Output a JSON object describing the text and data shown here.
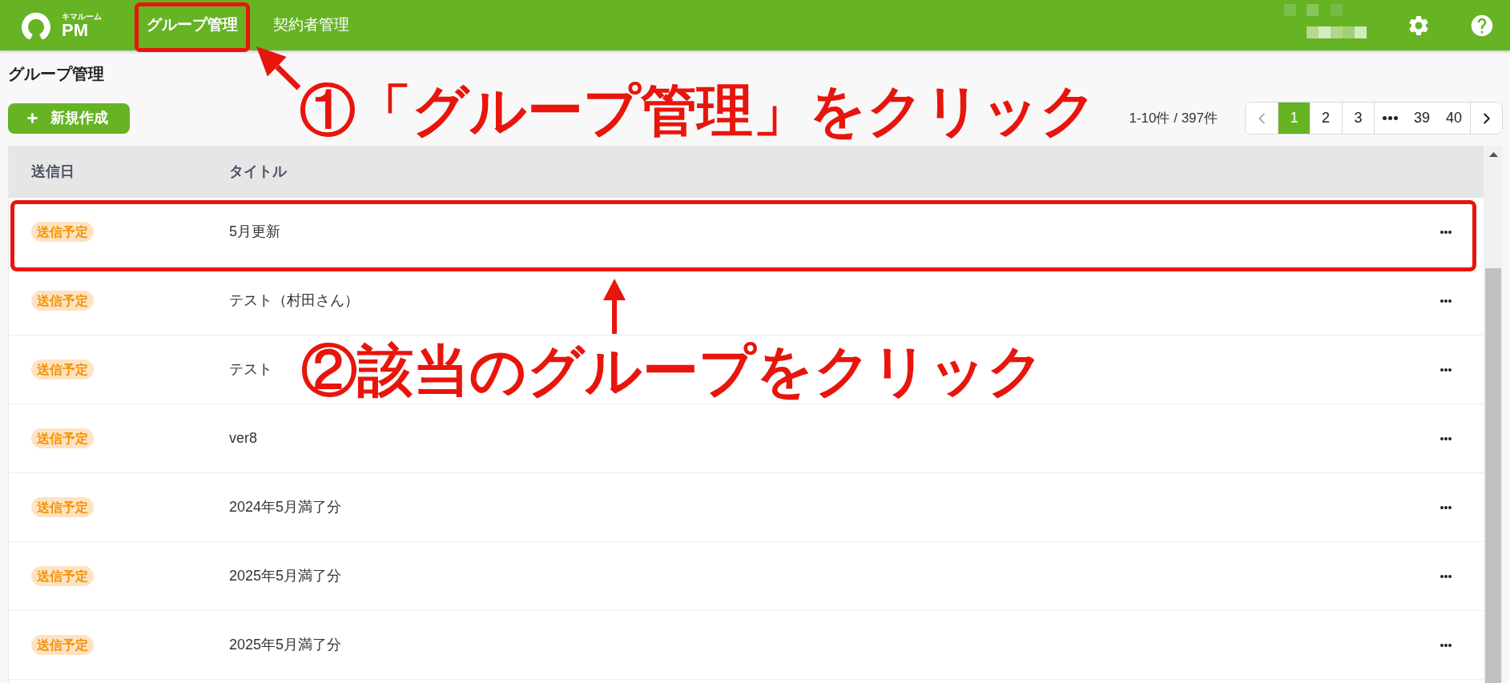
{
  "header": {
    "logo": {
      "caption": "キマルーム",
      "name": "PM"
    },
    "nav": [
      {
        "label": "グループ管理",
        "selected": true,
        "highlighted": true
      },
      {
        "label": "契約者管理",
        "selected": false,
        "highlighted": false
      }
    ]
  },
  "page": {
    "title": "グループ管理",
    "new_button": "新規作成",
    "count": "1-10件 / 397件"
  },
  "pagination": [
    {
      "kind": "prev",
      "disabled": true,
      "selected": false
    },
    {
      "kind": "page",
      "label": "1",
      "selected": true
    },
    {
      "kind": "page",
      "label": "2",
      "selected": false
    },
    {
      "kind": "page",
      "label": "3",
      "selected": false
    },
    {
      "kind": "ellipsis",
      "selected": false
    },
    {
      "kind": "page",
      "label": "39",
      "selected": false
    },
    {
      "kind": "page",
      "label": "40",
      "selected": false
    },
    {
      "kind": "next",
      "disabled": false,
      "selected": false
    }
  ],
  "table": {
    "columns": [
      "送信日",
      "タイトル"
    ],
    "rows": [
      {
        "status": "送信予定",
        "title": "5月更新",
        "highlighted": true
      },
      {
        "status": "送信予定",
        "title": "テスト（村田さん）",
        "highlighted": false
      },
      {
        "status": "送信予定",
        "title": "テスト",
        "highlighted": false
      },
      {
        "status": "送信予定",
        "title": "ver8",
        "highlighted": false
      },
      {
        "status": "送信予定",
        "title": "2024年5月満了分",
        "highlighted": false
      },
      {
        "status": "送信予定",
        "title": "2025年5月満了分",
        "highlighted": false
      },
      {
        "status": "送信予定",
        "title": "2025年5月満了分",
        "highlighted": false
      }
    ]
  },
  "annotations": [
    {
      "text": "①「グループ管理」をクリック"
    },
    {
      "text": "②該当のグループをクリック"
    }
  ]
}
